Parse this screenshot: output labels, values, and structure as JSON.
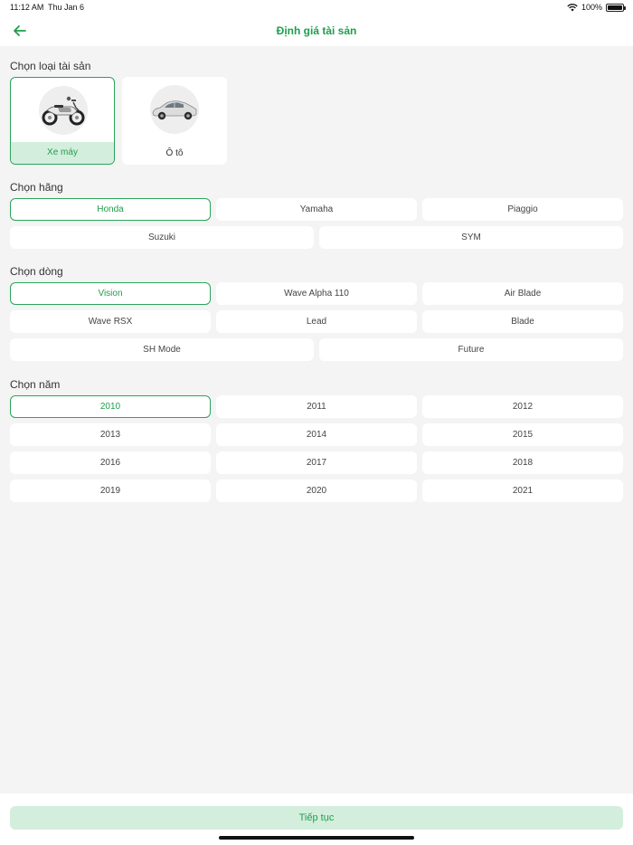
{
  "status": {
    "time": "11:12 AM",
    "date": "Thu Jan 6",
    "battery": "100%"
  },
  "colors": {
    "accent": "#1e9e4c",
    "selected_bg": "#d4eedd",
    "background": "#f4f4f4"
  },
  "header": {
    "title": "Định giá tài sản",
    "back_icon": "arrow-left-icon"
  },
  "asset_section": {
    "title": "Chọn loại tài sản",
    "items": [
      {
        "label": "Xe máy",
        "icon": "motorbike-icon",
        "selected": true
      },
      {
        "label": "Ô tô",
        "icon": "car-icon",
        "selected": false
      }
    ]
  },
  "brand_section": {
    "title": "Chọn hãng",
    "items": [
      "Honda",
      "Yamaha",
      "Piaggio",
      "Suzuki",
      "SYM"
    ],
    "selected": "Honda"
  },
  "model_section": {
    "title": "Chọn dòng",
    "items": [
      "Vision",
      "Wave Alpha 110",
      "Air Blade",
      "Wave RSX",
      "Lead",
      "Blade",
      "SH Mode",
      "Future"
    ],
    "selected": "Vision"
  },
  "year_section": {
    "title": "Chọn năm",
    "items": [
      "2010",
      "2011",
      "2012",
      "2013",
      "2014",
      "2015",
      "2016",
      "2017",
      "2018",
      "2019",
      "2020",
      "2021"
    ],
    "selected": "2010"
  },
  "footer": {
    "continue_label": "Tiếp tục"
  }
}
